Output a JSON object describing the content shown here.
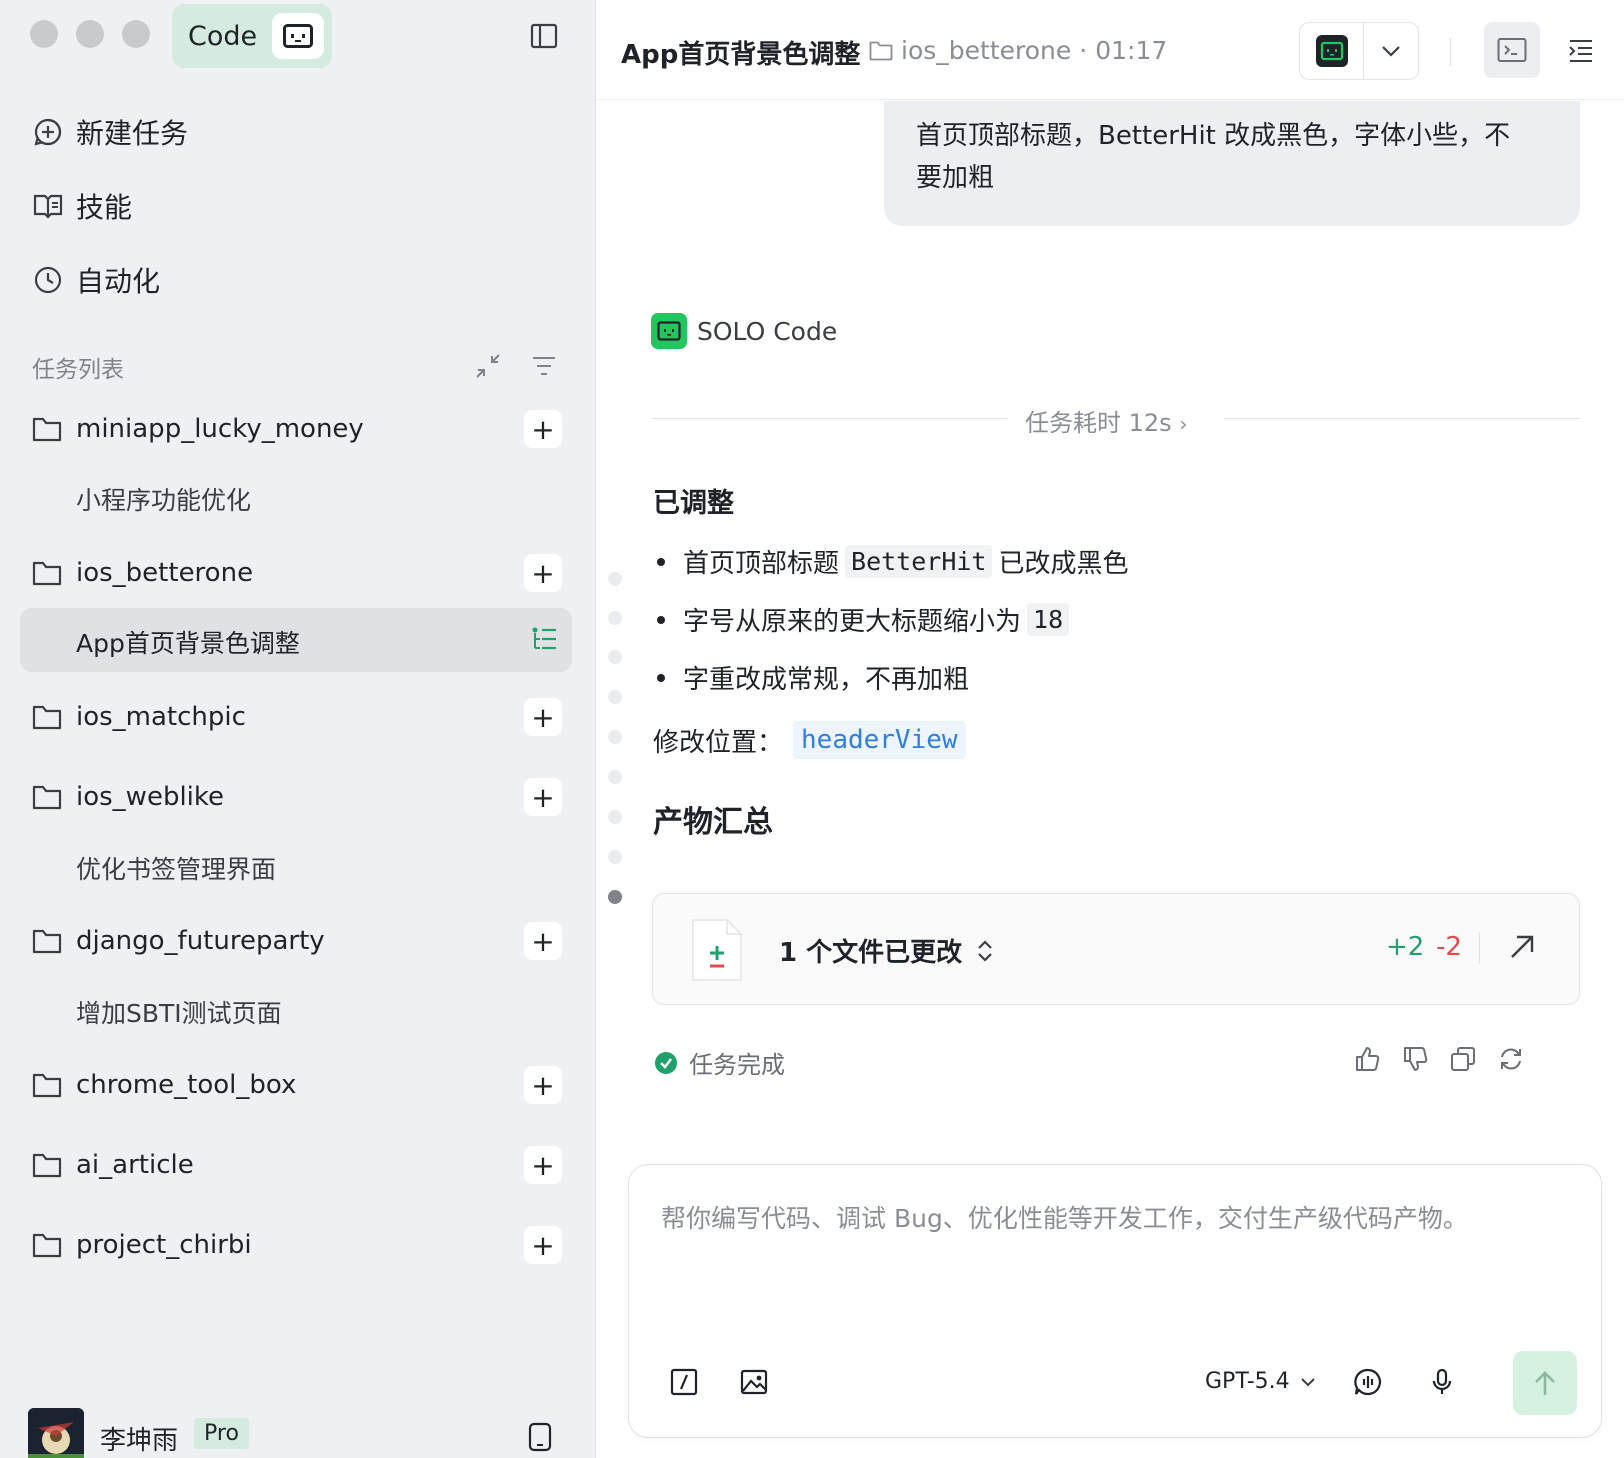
{
  "sidebar": {
    "app_label": "Code",
    "nav": [
      {
        "label": "新建任务",
        "icon": "add-task-icon"
      },
      {
        "label": "技能",
        "icon": "book-icon"
      },
      {
        "label": "自动化",
        "icon": "clock-icon"
      }
    ],
    "section_title": "任务列表",
    "projects": [
      {
        "name": "miniapp_lucky_money",
        "tasks": [
          "小程序功能优化"
        ]
      },
      {
        "name": "ios_betterone",
        "tasks": [
          "App首页背景色调整"
        ]
      },
      {
        "name": "ios_matchpic",
        "tasks": []
      },
      {
        "name": "ios_weblike",
        "tasks": [
          "优化书签管理界面"
        ]
      },
      {
        "name": "django_futureparty",
        "tasks": [
          "增加SBTI测试页面"
        ]
      },
      {
        "name": "chrome_tool_box",
        "tasks": []
      },
      {
        "name": "ai_article",
        "tasks": []
      },
      {
        "name": "project_chirbi",
        "tasks": []
      }
    ],
    "active_task": "App首页背景色调整",
    "user": {
      "name": "李坤雨",
      "plan": "Pro"
    }
  },
  "header": {
    "title": "App首页背景色调整",
    "project": "ios_betterone",
    "separator": "·",
    "time": "01:17"
  },
  "chat": {
    "user_message_line1": "首页顶部标题，BetterHit 改成黑色，字体小些，不",
    "user_message_line2": "要加粗",
    "agent_name": "SOLO Code",
    "duration": "任务耗时 12s",
    "heading_adjusted": "已调整",
    "bullets": {
      "b1_pre": "首页顶部标题",
      "b1_code": "BetterHit",
      "b1_post": "已改成黑色",
      "b2_pre": "字号从原来的更大标题缩小为",
      "b2_code": "18",
      "b3": "字重改成常规，不再加粗"
    },
    "location_label": "修改位置：",
    "location_code": "headerView",
    "heading_artifacts": "产物汇总",
    "files_changed": "1 个文件已更改",
    "additions": "+2",
    "deletions": "-2",
    "status": "任务完成"
  },
  "composer": {
    "placeholder": "帮你编写代码、调试 Bug、优化性能等开发工作，交付生产级代码产物。",
    "model": "GPT-5.4"
  },
  "colors": {
    "accent": "#22c55e",
    "addition": "#22a06b",
    "deletion": "#e5484d",
    "link": "#2f7fe0"
  }
}
